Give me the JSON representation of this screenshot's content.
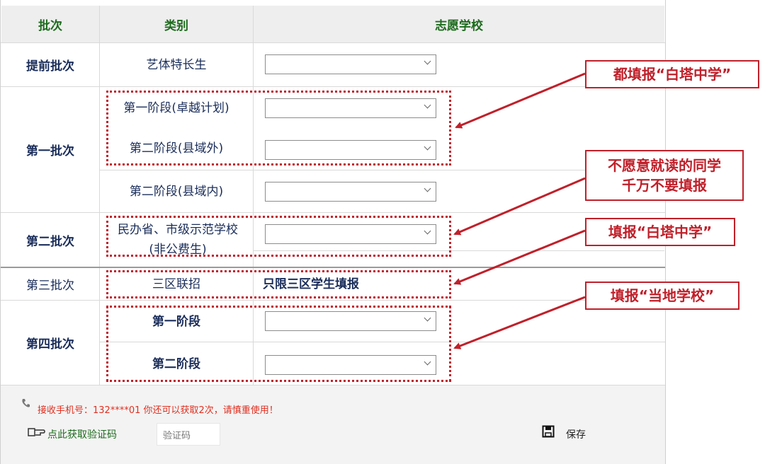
{
  "header": {
    "col_batch": "批次",
    "col_category": "类别",
    "col_school": "志愿学校"
  },
  "rows": {
    "early": {
      "batch": "提前批次",
      "category": "艺体特长生"
    },
    "first": {
      "batch": "第一批次",
      "cat1": "第一阶段(卓越计划)",
      "cat2": "第二阶段(县域外)",
      "cat3": "第二阶段(县域内)"
    },
    "second": {
      "batch": "第二批次",
      "cat_line1": "民办省、市级示范学校",
      "cat_line2": "(非公费生)"
    },
    "third": {
      "batch": "第三批次",
      "category": "三区联招",
      "school_note": "只限三区学生填报"
    },
    "fourth": {
      "batch": "第四批次",
      "cat1": "第一阶段",
      "cat2": "第二阶段"
    }
  },
  "callouts": {
    "c1": "都填报“白塔中学”",
    "c2_line1": "不愿意就读的同学",
    "c2_line2": "千万不要填报",
    "c3": "填报“白塔中学”",
    "c4": "填报“当地学校”"
  },
  "footer": {
    "notice": "接收手机号：132****01   你还可以获取2次，请慎重使用！",
    "get_code": "点此获取验证码",
    "code_placeholder": "验证码",
    "save": "保存"
  },
  "colors": {
    "header_text": "#1e6b1e",
    "body_text": "#1a2d5a",
    "annotation_red": "#c0202a",
    "notice_red": "#e03020"
  },
  "icons": [
    "chevron-down-icon",
    "phone-icon",
    "hand-pointer-icon",
    "save-disk-icon"
  ]
}
